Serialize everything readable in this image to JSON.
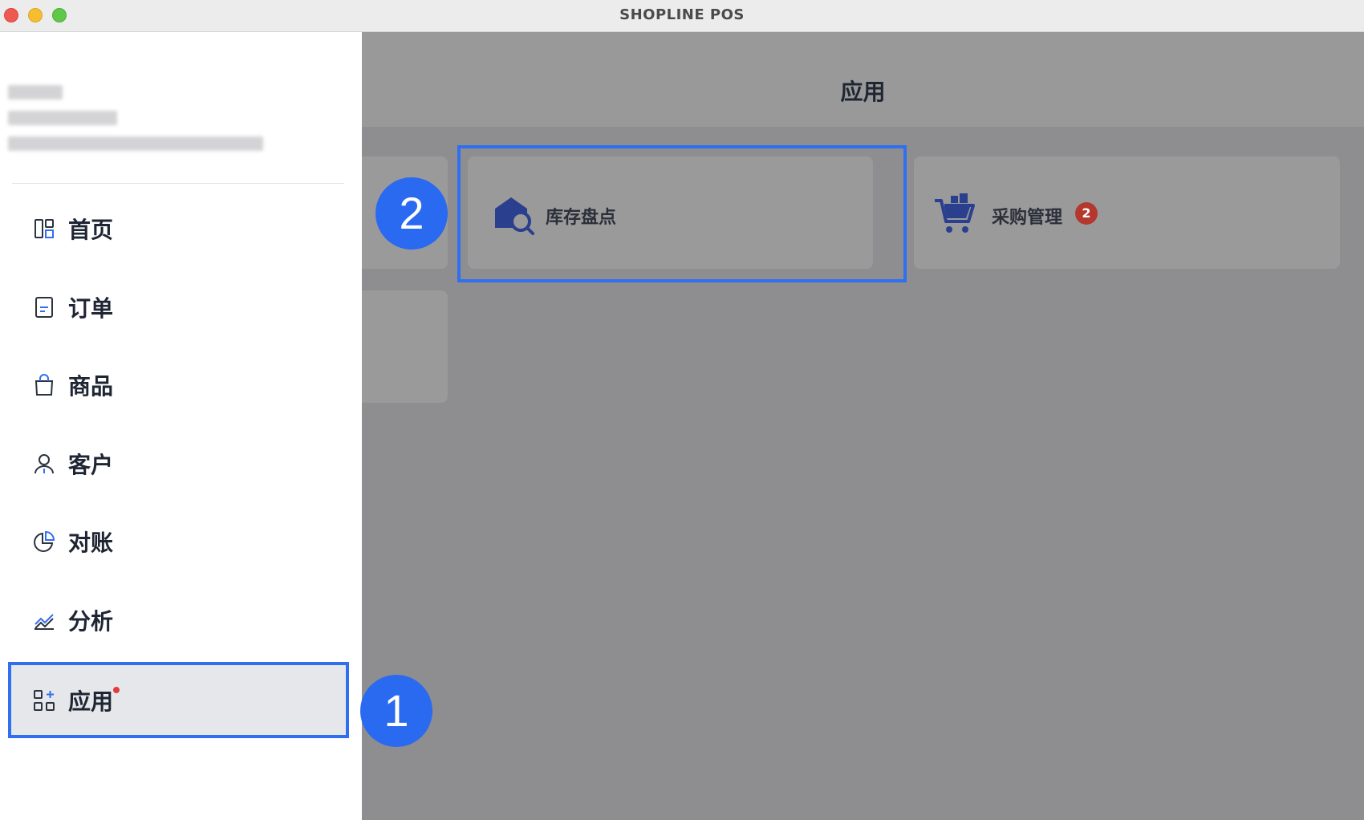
{
  "window": {
    "title": "SHOPLINE POS"
  },
  "sidebar": {
    "items": [
      {
        "label": "首页",
        "icon": "dashboard-icon"
      },
      {
        "label": "订单",
        "icon": "order-icon"
      },
      {
        "label": "商品",
        "icon": "shopping-bag-icon"
      },
      {
        "label": "客户",
        "icon": "user-icon"
      },
      {
        "label": "对账",
        "icon": "pie-chart-icon"
      },
      {
        "label": "分析",
        "icon": "analytics-icon"
      },
      {
        "label": "应用",
        "icon": "apps-icon",
        "active": true,
        "has_dot": true
      }
    ]
  },
  "main": {
    "title": "应用",
    "cards": [
      {
        "label": "库存盘点",
        "icon": "inventory-search-icon"
      },
      {
        "label": "采购管理",
        "icon": "cart-icon",
        "badge": "2"
      }
    ]
  },
  "annotations": {
    "step1": "1",
    "step2": "2"
  },
  "colors": {
    "accent": "#2f6ff0",
    "icon_blue": "#2b3f8f",
    "badge_red": "#b4382d",
    "dot_red": "#e23d3d"
  }
}
